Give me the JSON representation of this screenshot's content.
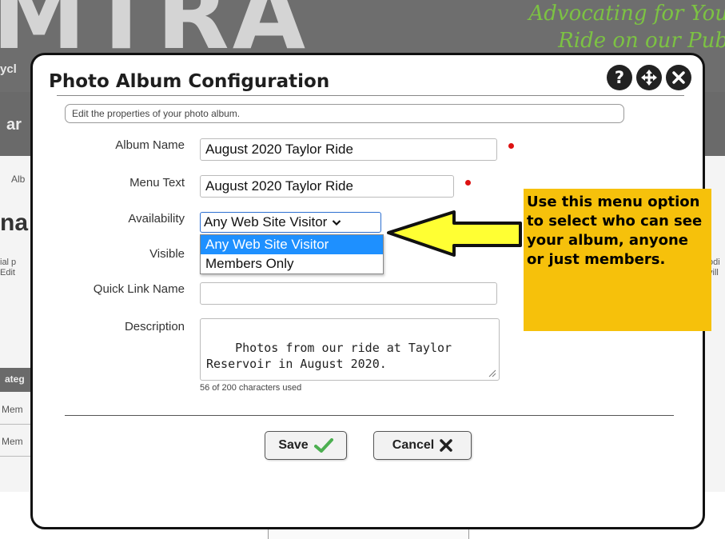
{
  "background": {
    "logo_text": "MTRA",
    "tagline_1": "Advocating for You",
    "tagline_2": "Ride on our Pub",
    "subtitle_fragment": "ycl",
    "nav_fragment": "ar",
    "breadcrumb_fragment": "Alb",
    "heading_fragment": "na",
    "text_fragment_1": "ial p",
    "text_fragment_2": "Edit",
    "right_fragment_1": "odi",
    "right_fragment_2": "vill",
    "category_header": "ateg",
    "row_1": "Mem",
    "row_2": "Mem"
  },
  "dialog": {
    "title": "Photo Album Configuration",
    "intro": "Edit the properties of your photo album.",
    "controls": {
      "help_icon": "?",
      "move_icon": "move-arrows",
      "close_icon": "x"
    },
    "fields": {
      "album_name": {
        "label": "Album Name",
        "value": "August 2020 Taylor Ride"
      },
      "menu_text": {
        "label": "Menu Text",
        "value": "August 2020 Taylor Ride"
      },
      "availability": {
        "label": "Availability",
        "value": "Any Web Site Visitor",
        "options": [
          "Any Web Site Visitor",
          "Members Only"
        ]
      },
      "visible": {
        "label": "Visible"
      },
      "quick_link": {
        "label": "Quick Link Name",
        "value": ""
      },
      "description": {
        "label": "Description",
        "value": "Photos from our ride at Taylor Reservoir in August 2020.",
        "counter": "56 of 200 characters used"
      }
    },
    "buttons": {
      "save": "Save",
      "cancel": "Cancel"
    }
  },
  "callout": {
    "text": "Use this menu option to select who can see your album, anyone or just members."
  },
  "colors": {
    "required_dot": "#dd1111",
    "selected_option": "#1e90ff",
    "callout": "#f6c10b",
    "arrow_fill": "#ffff33",
    "save_check": "#4caf50",
    "cancel_x": "#222222"
  }
}
